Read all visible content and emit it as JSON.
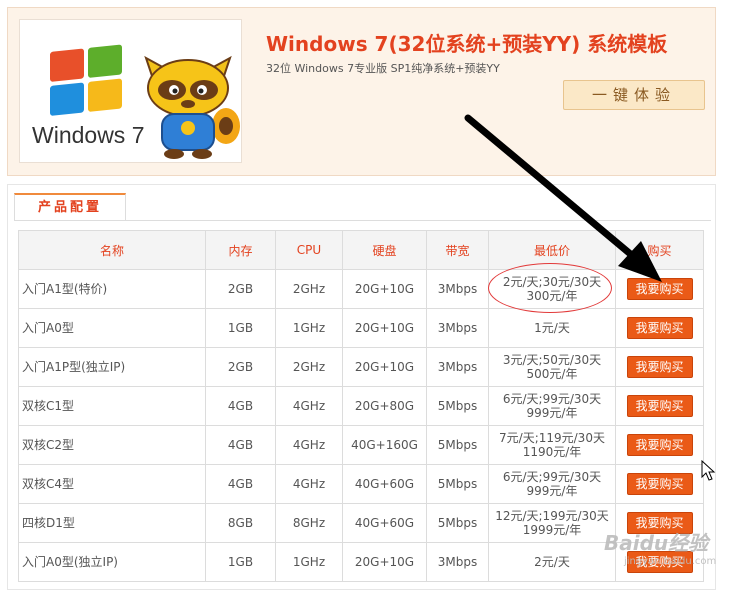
{
  "header": {
    "logo_text": "Windows 7",
    "title": "Windows 7(32位系统+预装YY) 系统模板",
    "subtitle": "32位 Windows 7专业版 SP1纯净系统+预装YY",
    "try_label": "一键体验"
  },
  "config": {
    "tab_label": "产品配置",
    "columns": [
      "名称",
      "内存",
      "CPU",
      "硬盘",
      "带宽",
      "最低价",
      "购买"
    ],
    "buy_label": "我要购买",
    "rows": [
      {
        "name": "入门A1型(特价)",
        "mem": "2GB",
        "cpu": "2GHz",
        "disk": "20G+10G",
        "bw": "3Mbps",
        "price1": "2元/天;30元/30天",
        "price2": "300元/年"
      },
      {
        "name": "入门A0型",
        "mem": "1GB",
        "cpu": "1GHz",
        "disk": "20G+10G",
        "bw": "3Mbps",
        "price1": "1元/天",
        "price2": ""
      },
      {
        "name": "入门A1P型(独立IP)",
        "mem": "2GB",
        "cpu": "2GHz",
        "disk": "20G+10G",
        "bw": "3Mbps",
        "price1": "3元/天;50元/30天",
        "price2": "500元/年"
      },
      {
        "name": "双核C1型",
        "mem": "4GB",
        "cpu": "4GHz",
        "disk": "20G+80G",
        "bw": "5Mbps",
        "price1": "6元/天;99元/30天",
        "price2": "999元/年"
      },
      {
        "name": "双核C2型",
        "mem": "4GB",
        "cpu": "4GHz",
        "disk": "40G+160G",
        "bw": "5Mbps",
        "price1": "7元/天;119元/30天",
        "price2": "1190元/年"
      },
      {
        "name": "双核C4型",
        "mem": "4GB",
        "cpu": "4GHz",
        "disk": "40G+60G",
        "bw": "5Mbps",
        "price1": "6元/天;99元/30天",
        "price2": "999元/年"
      },
      {
        "name": "四核D1型",
        "mem": "8GB",
        "cpu": "8GHz",
        "disk": "40G+60G",
        "bw": "5Mbps",
        "price1": "12元/天;199元/30天",
        "price2": "1999元/年"
      },
      {
        "name": "入门A0型(独立IP)",
        "mem": "1GB",
        "cpu": "1GHz",
        "disk": "20G+10G",
        "bw": "3Mbps",
        "price1": "2元/天",
        "price2": ""
      }
    ]
  },
  "watermark": {
    "text": "Baidu经验",
    "url": "jingyan.baidu.com"
  },
  "colors": {
    "accent": "#e3421f",
    "button": "#ea5a17",
    "annotation": "#e23a3a"
  }
}
